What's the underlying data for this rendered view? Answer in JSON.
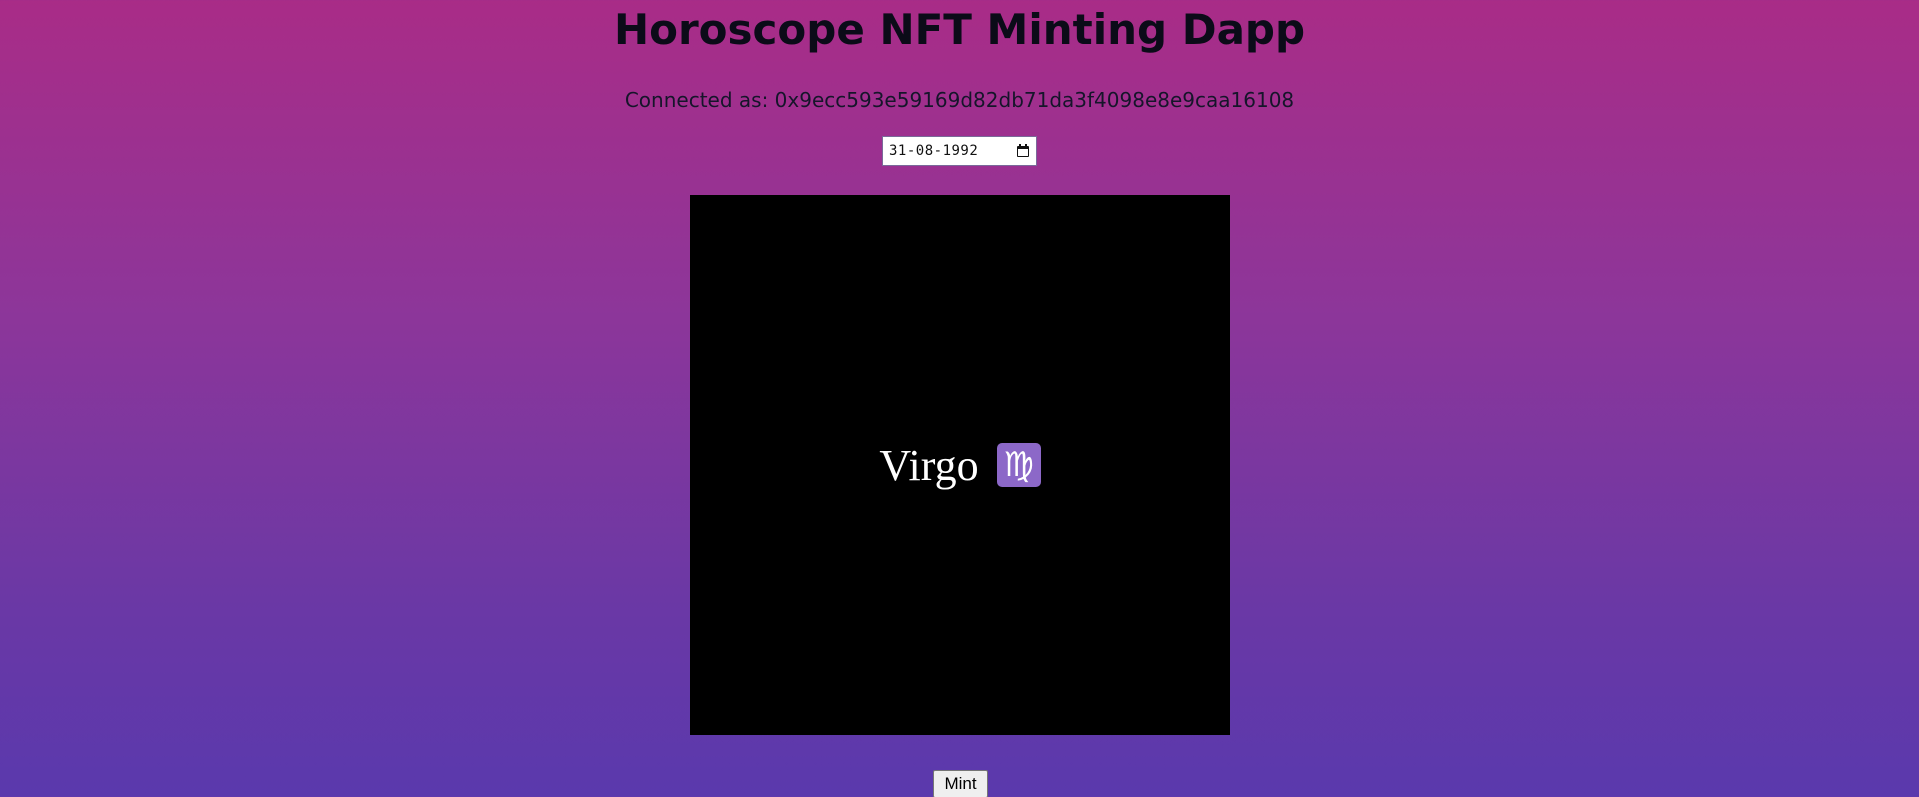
{
  "header": {
    "title": "Horoscope NFT Minting Dapp"
  },
  "account": {
    "connected_text": "Connected as: 0x9ecc593e59169d82db71da3f4098e8e9caa16108"
  },
  "birth_date": {
    "value": "31-08-1992",
    "icon": "calendar-icon"
  },
  "nft_preview": {
    "sign_name": "Virgo",
    "sign_symbol": "♍",
    "background_color": "#000000",
    "badge_color": "#8c68c8"
  },
  "actions": {
    "mint_label": "Mint"
  }
}
